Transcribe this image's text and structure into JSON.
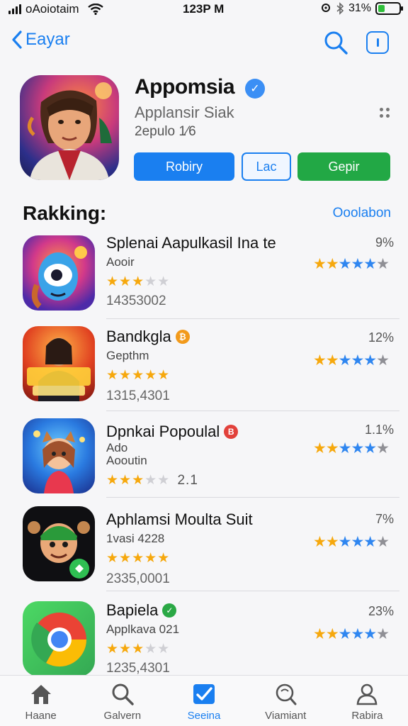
{
  "status_bar": {
    "carrier": "oAoiotaim",
    "time": "123P M",
    "battery": "31%",
    "battery_level": 0.31
  },
  "nav": {
    "back_label": "Eayar"
  },
  "hero": {
    "title": "Appomsia",
    "subtitle": "Applansir Siak",
    "size": "2epulo 1⁄6",
    "buttons": {
      "primary": "Robiry",
      "outline": "Lac",
      "green": "Gepir"
    }
  },
  "section": {
    "title": "Rakking:",
    "link": "Ooolabon"
  },
  "apps": [
    {
      "title": "Splenai Aapulkasil Ina te",
      "subtitle": "Aooir",
      "subtitle2": "",
      "stars_text": "★★★",
      "stars_gray": "★★",
      "count": "14353002",
      "percent": "9%",
      "badge": "",
      "rating": 4
    },
    {
      "title": "Bandkgla",
      "subtitle": "Gepthm",
      "subtitle2": "",
      "stars_text": "★★★★★",
      "stars_gray": "",
      "count": "1315,4301",
      "percent": "12%",
      "badge": "orange",
      "rating": 3.5
    },
    {
      "title": "Dpnkai Popoulal",
      "subtitle": "Ado",
      "subtitle2": "Aooutin",
      "stars_text": "★★★",
      "stars_gray": "★★",
      "count": "2.1",
      "percent": "1.1%",
      "badge": "red",
      "rating": 3.5
    },
    {
      "title": "Aphlamsi Moulta Suit",
      "subtitle": "1vasi 4228",
      "subtitle2": "",
      "stars_text": "★★★★★",
      "stars_gray": "",
      "count": "2335,0001",
      "percent": "7%",
      "badge": "",
      "rating": 3.5
    },
    {
      "title": "Bapiela",
      "subtitle": "Applkava 021",
      "subtitle2": "",
      "stars_text": "★★★",
      "stars_gray": "★★",
      "count": "1235,4301",
      "percent": "23%",
      "badge": "green",
      "rating": 4.5
    }
  ],
  "tabs": [
    {
      "label": "Haane",
      "icon": "home-icon"
    },
    {
      "label": "Galvern",
      "icon": "search-icon"
    },
    {
      "label": "Seeina",
      "icon": "check-icon",
      "active": true
    },
    {
      "label": "Viamiant",
      "icon": "search-alt-icon"
    },
    {
      "label": "Rabira",
      "icon": "person-icon"
    }
  ],
  "colors": {
    "accent": "#1a7ff0",
    "green": "#22a845",
    "star_gold": "#f6a80d"
  }
}
